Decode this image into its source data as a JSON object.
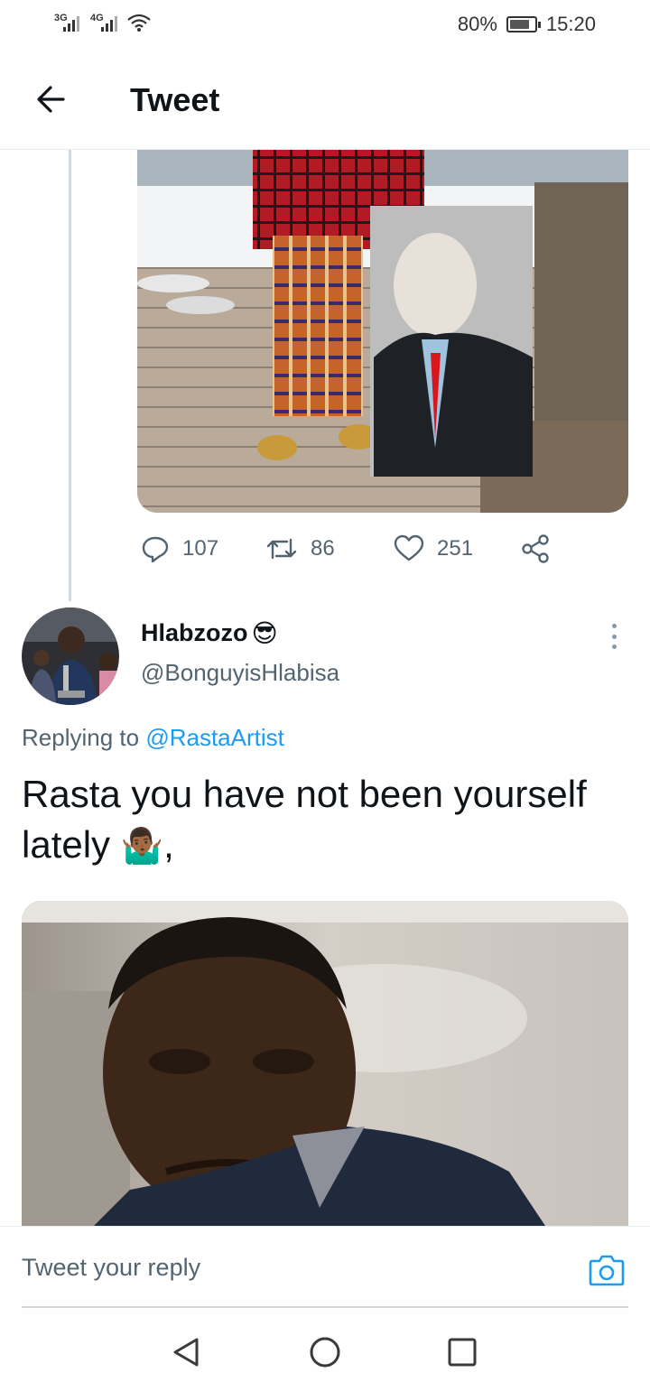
{
  "status_bar": {
    "signal1_label": "3G",
    "signal2_label": "4G",
    "battery": "80%",
    "battery_level": 0.8,
    "time": "15:20",
    "wifi_icon": "wifi-icon"
  },
  "header": {
    "title": "Tweet",
    "back_icon": "arrow-left-icon"
  },
  "tweet": {
    "actions": {
      "replies": "107",
      "retweets": "86",
      "likes": "251"
    }
  },
  "reply": {
    "name": "Hlabzozo",
    "name_emoji": "😎",
    "handle": "@BonguyisHlabisa",
    "replying_prefix": "Replying to",
    "replying_to": "@RastaArtist",
    "text": "Rasta you have not been yourself lately",
    "text_emoji": "🤷🏾‍♂️",
    "text_suffix": ","
  },
  "composer": {
    "placeholder": "Tweet your reply",
    "camera_icon": "camera-icon"
  },
  "colors": {
    "accent": "#1d9bf0",
    "muted": "#536471",
    "text": "#0f1419"
  }
}
